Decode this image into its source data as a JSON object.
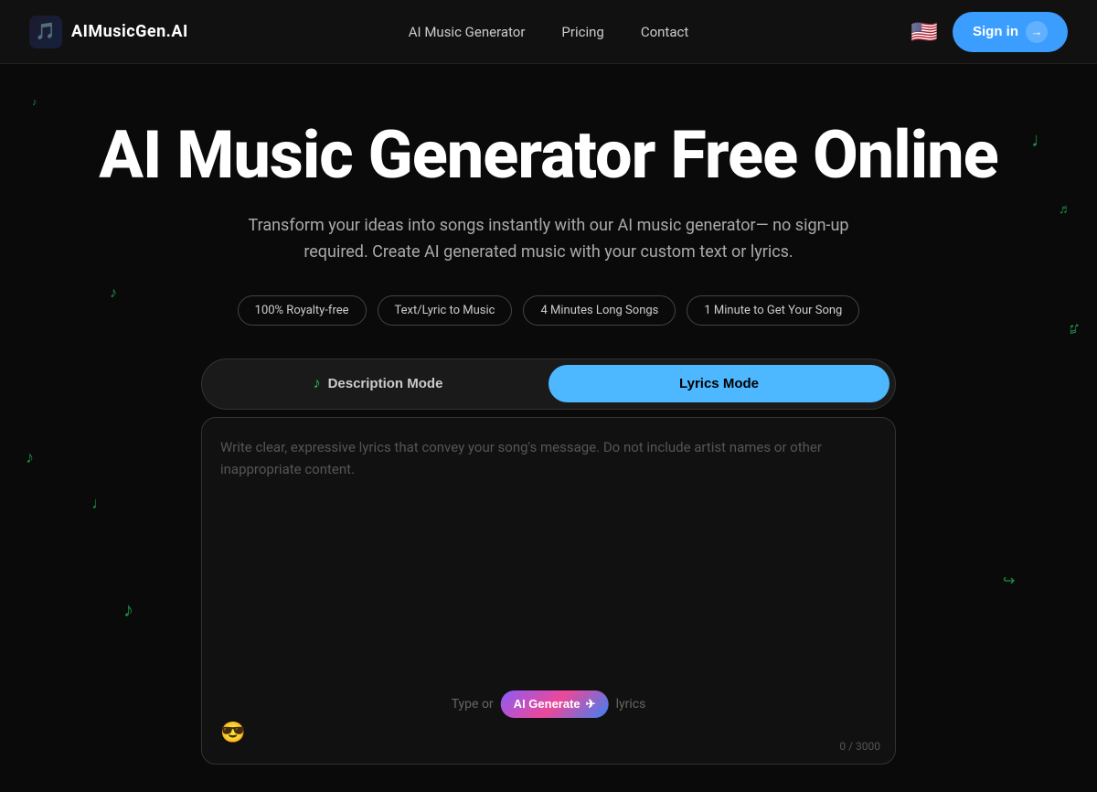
{
  "navbar": {
    "logo_icon": "🎵",
    "logo_text": "AIMusicGen.AI",
    "links": [
      {
        "label": "AI Music Generator",
        "id": "nav-music-gen"
      },
      {
        "label": "Pricing",
        "id": "nav-pricing"
      },
      {
        "label": "Contact",
        "id": "nav-contact"
      }
    ],
    "flag": "🇺🇸",
    "signin_label": "Sign in",
    "signin_arrow": "→"
  },
  "hero": {
    "title": "AI Music Generator Free Online",
    "subtitle": "Transform your ideas into songs instantly with our AI music generator— no sign-up required. Create AI generated music with your custom text or lyrics.",
    "pills": [
      {
        "label": "100% Royalty-free"
      },
      {
        "label": "Text/Lyric to Music"
      },
      {
        "label": "4 Minutes Long Songs"
      },
      {
        "label": "1 Minute to Get Your Song"
      }
    ]
  },
  "modes": {
    "description_label": "Description Mode",
    "lyrics_label": "Lyrics Mode",
    "music_note": "♪"
  },
  "textarea": {
    "placeholder": "Write clear, expressive lyrics that convey your song's message. Do not include artist names or other inappropriate content.",
    "emoji": "😎",
    "ai_generate_label": "AI Generate",
    "ai_generate_icon": "✈",
    "hint_prefix": "Type or",
    "hint_suffix": "lyrics",
    "char_count": "0 / 3000"
  },
  "floating_notes": [
    "♩",
    "♪",
    "♫",
    "♬",
    "𝄞",
    "♩",
    "♪",
    "♬",
    "♫",
    "♩"
  ]
}
